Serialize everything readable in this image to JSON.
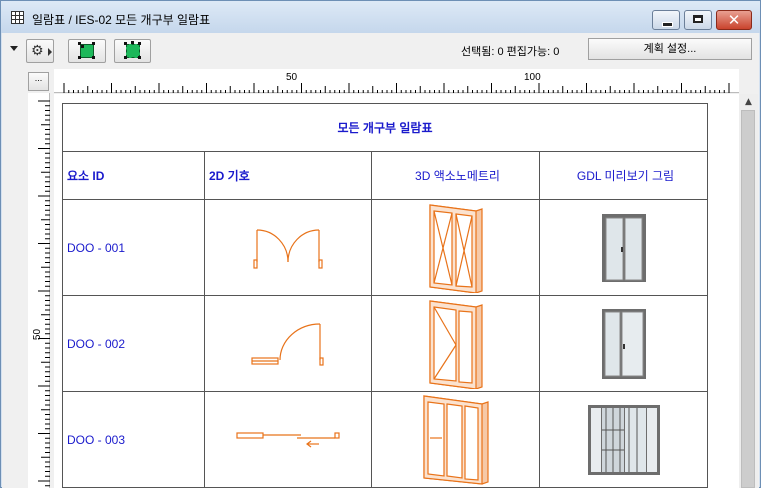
{
  "window": {
    "title": "일람표 / IES-02 모든 개구부 일람표",
    "close_glyph": "✕"
  },
  "toolbar": {
    "status": "선택됨: 0  편집가능: 0",
    "settings_label": "계획 설정...",
    "gear_glyph": "⚙"
  },
  "rulers": {
    "corner_label": "...",
    "h_labels": [
      "50",
      "100"
    ],
    "v_labels": [
      "50"
    ]
  },
  "scrollbar": {
    "up_glyph": "▲"
  },
  "schedule": {
    "title": "모든 개구부 일람표",
    "headers": [
      "요소 ID",
      "2D 기호",
      "3D 액소노메트리",
      "GDL 미리보기 그림"
    ],
    "rows": [
      {
        "id": "DOO - 001"
      },
      {
        "id": "DOO - 002"
      },
      {
        "id": "DOO - 003"
      }
    ]
  },
  "colors": {
    "schedule_text": "#1a1acc",
    "symbol_orange": "#e8731a",
    "title_gradient_top": "#dde9f6",
    "close_red": "#c9432d"
  }
}
